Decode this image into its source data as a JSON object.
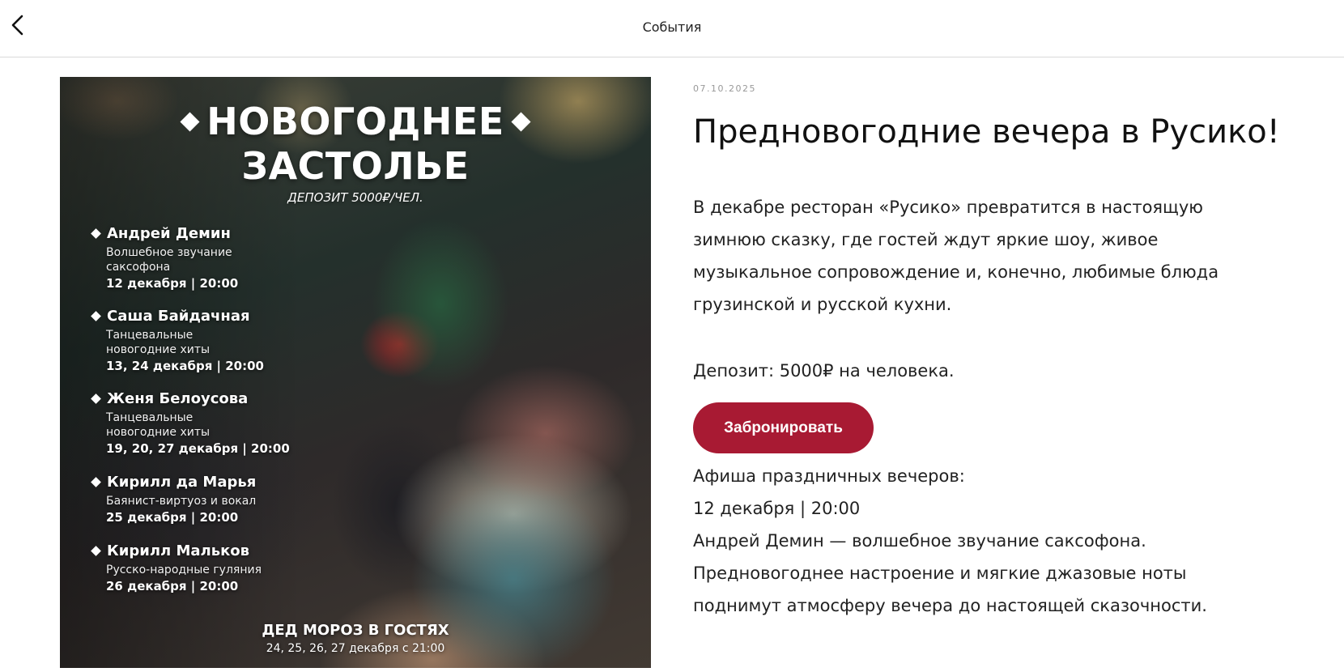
{
  "header": {
    "title": "События",
    "back_icon": "chevron-left-icon"
  },
  "poster": {
    "title_line1": "НОВОГОДНЕЕ",
    "title_line2": "ЗАСТОЛЬЕ",
    "deposit": "ДЕПОЗИТ 5000₽/ЧЕЛ.",
    "acts": [
      {
        "name": "Андрей Демин",
        "desc": "Волшебное звучание саксофона",
        "date": "12 декабря | 20:00"
      },
      {
        "name": "Саша Байдачная",
        "desc": "Танцевальные новогодние хиты",
        "date": "13, 24 декабря | 20:00"
      },
      {
        "name": "Женя Белоусова",
        "desc": "Танцевальные новогодние хиты",
        "date": "19, 20, 27 декабря | 20:00"
      },
      {
        "name": "Кирилл да Марья",
        "desc": "Баянист-виртуоз и вокал",
        "date": "25 декабря | 20:00"
      },
      {
        "name": "Кирилл Мальков",
        "desc": "Русско-народные гуляния",
        "date": "26 декабря | 20:00"
      }
    ],
    "santa_title": "ДЕД МОРОЗ В ГОСТЯХ",
    "santa_dates": "24, 25, 26, 27 декабря с 21:00"
  },
  "article": {
    "date": "07.10.2025",
    "title": "Предновогодние вечера в Русико!",
    "intro": "В декабре ресторан «Русико» превратится в настоящую зимнюю сказку, где гостей ждут яркие шоу, живое музыкальное сопровождение и, конечно, любимые блюда грузинской и русской кухни.",
    "deposit": "Депозит: 5000₽ на человека.",
    "book_label": "Забронировать",
    "afisha_heading": "Афиша праздничных вечеров:",
    "afisha_date": "12 декабря | 20:00",
    "afisha_act": "Андрей Демин — волшебное звучание саксофона.",
    "afisha_desc": "Предновогоднее настроение и мягкие джазовые ноты поднимут атмосферу вечера до настоящей сказочности."
  },
  "colors": {
    "accent": "#a81a33",
    "divider": "#d9d9d9",
    "muted": "#999999"
  }
}
